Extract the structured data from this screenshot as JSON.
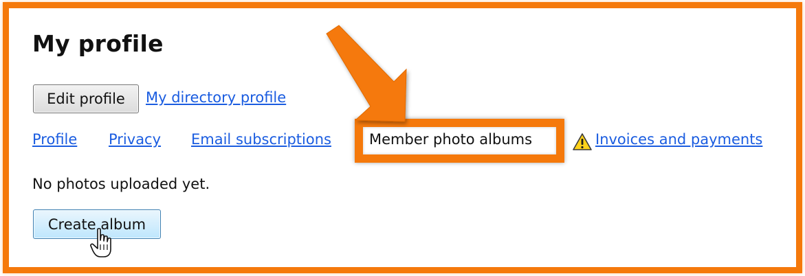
{
  "page": {
    "title": "My profile"
  },
  "actions": {
    "edit_profile_label": "Edit profile",
    "directory_link_label": "My directory profile"
  },
  "tabs": [
    {
      "label": "Profile",
      "active": false
    },
    {
      "label": "Privacy",
      "active": false
    },
    {
      "label": "Email subscriptions",
      "active": false
    },
    {
      "label": "Member photo albums",
      "active": true
    },
    {
      "label": "Invoices and payments",
      "active": false,
      "icon": "warning-icon"
    }
  ],
  "albums": {
    "empty_message": "No photos uploaded yet.",
    "create_label": "Create album"
  },
  "annotations": {
    "accent_color": "#f5790b",
    "arrow_icon": "callout-arrow-icon",
    "cursor_icon": "hand-pointer-icon"
  }
}
